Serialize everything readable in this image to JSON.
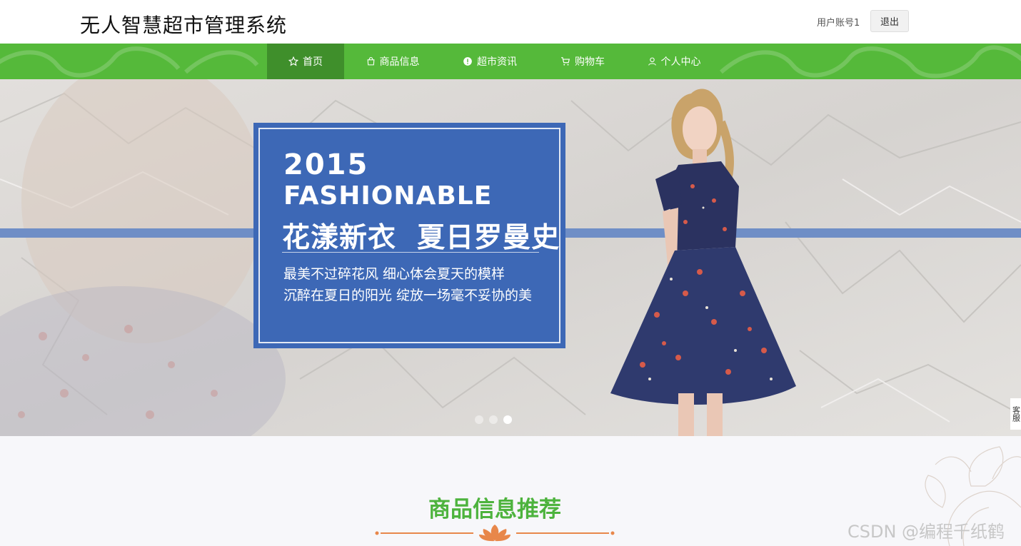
{
  "header": {
    "site_title": "无人智慧超市管理系统",
    "account_label": "用户账号1",
    "logout_label": "退出"
  },
  "nav": {
    "items": [
      {
        "label": "首页",
        "icon": "star-icon",
        "active": true
      },
      {
        "label": "商品信息",
        "icon": "bag-icon",
        "active": false
      },
      {
        "label": "超市资讯",
        "icon": "info-circle-icon",
        "active": false
      },
      {
        "label": "购物车",
        "icon": "cart-icon",
        "active": false
      },
      {
        "label": "个人中心",
        "icon": "user-icon",
        "active": false
      }
    ]
  },
  "banner": {
    "year": "2015",
    "headline": "FASHIONABLE",
    "cn_title": "花漾新衣  夏日罗曼史",
    "line1": "最美不过碎花风 细心体会夏天的模样",
    "line2": "沉醉在夏日的阳光 绽放一场毫不妥协的美",
    "slide_count": 3,
    "active_slide": 3,
    "side_tab": "客服"
  },
  "section": {
    "title": "商品信息推荐"
  },
  "watermark": "CSDN @编程千纸鹤",
  "colors": {
    "nav_green": "#55b93a",
    "nav_active": "#3f8f2b",
    "banner_blue": "#3d68b6",
    "section_title_green": "#4db33d",
    "deco_orange": "#e8874a"
  }
}
